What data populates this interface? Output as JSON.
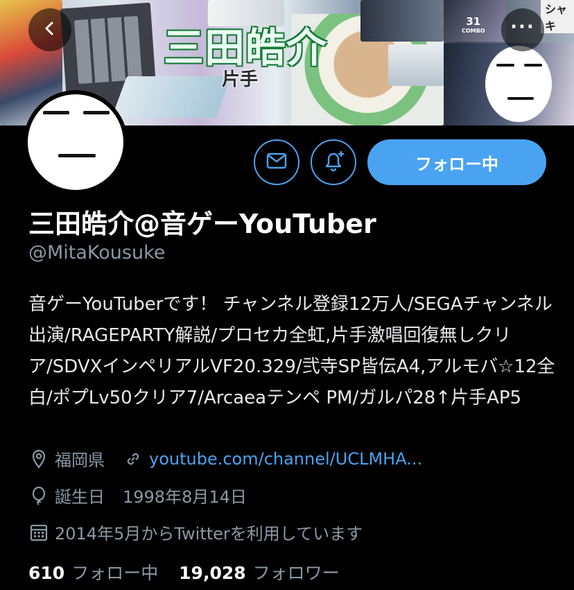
{
  "banner": {
    "title": "三田皓介",
    "subtitle": "片手",
    "combo_number": "31",
    "combo_label": "COMBO",
    "corner_text": "シャキ"
  },
  "nav": {
    "back_icon": "chevron-left-icon",
    "more_icon": "more-horizontal-icon",
    "more_label": "···"
  },
  "profile": {
    "display_name": "三田皓介@音ゲーYouTuber",
    "handle": "@MitaKousuke",
    "bio": "音ゲーYouTuberです！ チャンネル登録12万人/SEGAチャンネル出演/RAGEPARTY解説/プロセカ全虹,片手激唱回復無しクリア/SDVXインペリアルVF20.329/弐寺SP皆伝A4,アルモバ☆12全白/ポプLv50クリア7/Arcaeaテンペ PM/ガルパ28↑片手AP5"
  },
  "actions": {
    "message_icon": "mail-icon",
    "notify_icon": "bell-plus-icon",
    "follow_label": "フォロー中"
  },
  "meta": {
    "location": "福岡県",
    "location_icon": "location-pin-icon",
    "url": "youtube.com/channel/UCLMHA...",
    "url_icon": "link-icon",
    "birthday_label": "誕生日",
    "birthday": "1998年8月14日",
    "birthday_icon": "balloon-icon",
    "joined": "2014年5月からTwitterを利用しています",
    "joined_icon": "calendar-icon"
  },
  "counts": {
    "following_count": "610",
    "following_label": "フォロー中",
    "followers_count": "19,028",
    "followers_label": "フォロワー"
  },
  "colors": {
    "accent": "#4aa3f0",
    "background": "#000000",
    "muted_text": "#8b98a5"
  }
}
